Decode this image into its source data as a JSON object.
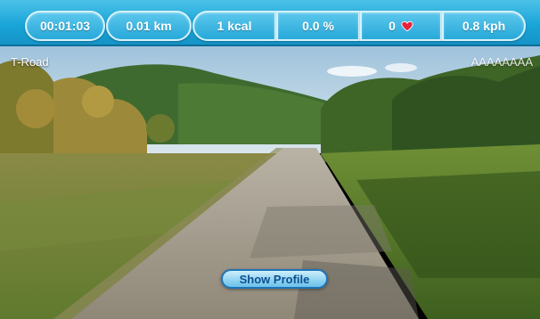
{
  "stats": {
    "time": "00:01:03",
    "distance": "0.01 km",
    "calories": "1 kcal",
    "incline": "0.0 %",
    "heart_rate": "0",
    "speed": "0.8 kph"
  },
  "heart_icon": "heart-icon",
  "colors": {
    "bar": "#1aa5d8",
    "pill_border": "#d6f2fb",
    "button_text": "#0b4f91",
    "heart": "#e8233b"
  },
  "route": {
    "name": "T-Road",
    "code": "AAAAAAAA"
  },
  "show_profile_label": "Show Profile"
}
